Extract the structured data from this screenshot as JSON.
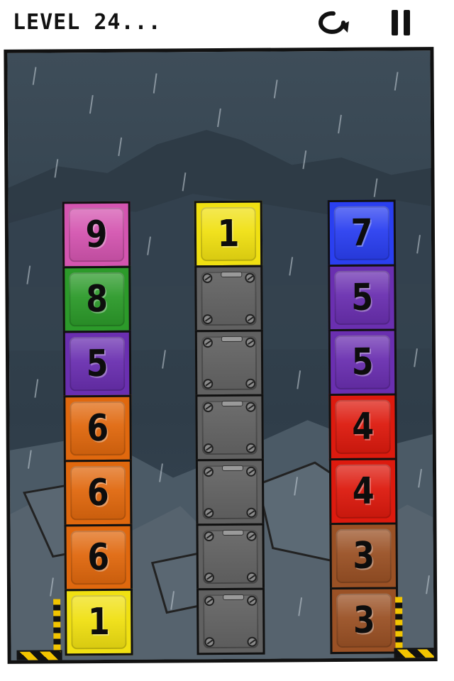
{
  "header": {
    "level_label": "LEVEL 24...",
    "restart_icon": "restart-icon",
    "pause_icon": "pause-icon"
  },
  "colors": {
    "pink": "#d455b0",
    "green": "#2c9a2a",
    "purple": "#6a2fb0",
    "orange": "#e0680e",
    "yellow": "#f0e012",
    "blue": "#2a3ff0",
    "red": "#dd1a0e",
    "brown": "#9a5125",
    "steel": "#616161"
  },
  "columns": [
    {
      "name": "left",
      "blocks": [
        {
          "label": "9",
          "color": "pink"
        },
        {
          "label": "8",
          "color": "green"
        },
        {
          "label": "5",
          "color": "purple"
        },
        {
          "label": "6",
          "color": "orange"
        },
        {
          "label": "6",
          "color": "orange"
        },
        {
          "label": "6",
          "color": "orange"
        },
        {
          "label": "1",
          "color": "yellow"
        }
      ]
    },
    {
      "name": "middle",
      "blocks": [
        {
          "label": "1",
          "color": "yellow"
        },
        {
          "label": "",
          "color": "steel"
        },
        {
          "label": "",
          "color": "steel"
        },
        {
          "label": "",
          "color": "steel"
        },
        {
          "label": "",
          "color": "steel"
        },
        {
          "label": "",
          "color": "steel"
        },
        {
          "label": "",
          "color": "steel"
        }
      ]
    },
    {
      "name": "right",
      "blocks": [
        {
          "label": "7",
          "color": "blue"
        },
        {
          "label": "5",
          "color": "purple"
        },
        {
          "label": "5",
          "color": "purple"
        },
        {
          "label": "4",
          "color": "red"
        },
        {
          "label": "4",
          "color": "red"
        },
        {
          "label": "3",
          "color": "brown"
        },
        {
          "label": "3",
          "color": "brown"
        }
      ]
    }
  ]
}
